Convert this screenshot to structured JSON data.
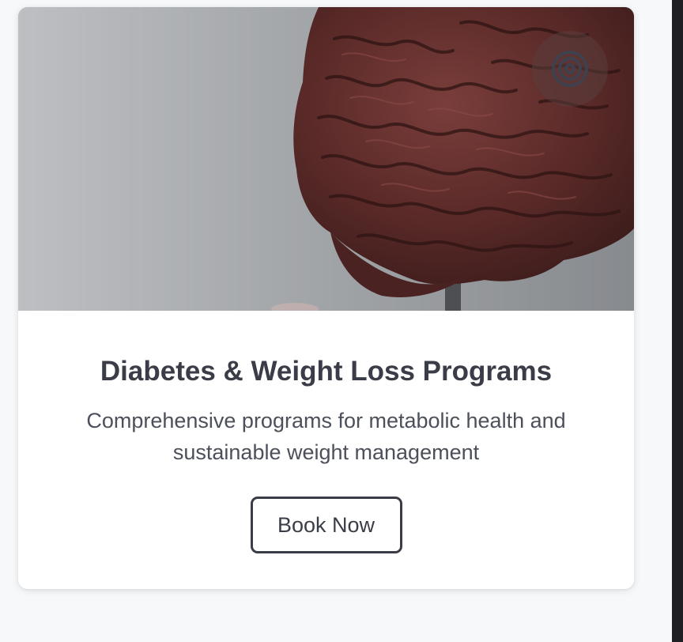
{
  "service_card": {
    "image_alt": "Anatomical brain model",
    "icon": "target-icon",
    "title": "Diabetes & Weight Loss Programs",
    "description": "Comprehensive programs for metabolic health and sustainable weight management",
    "cta_label": "Book Now"
  },
  "colors": {
    "page_background": "#f7f8fa",
    "card_background": "#ffffff",
    "text_primary": "#3a3d47",
    "text_secondary": "#4b505a",
    "brain": "#5a2a28"
  }
}
